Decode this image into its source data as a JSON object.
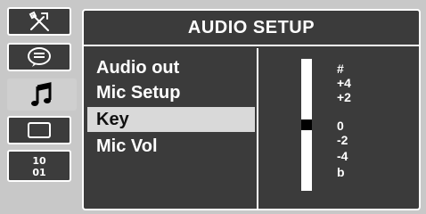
{
  "sidebar": {
    "tabs": [
      {
        "icon": "tools-icon",
        "active": false
      },
      {
        "icon": "speech-bubble-icon",
        "active": false
      },
      {
        "icon": "music-note-icon",
        "active": true
      },
      {
        "icon": "screen-icon",
        "active": false
      },
      {
        "icon": "numbers-icon",
        "active": false,
        "label": "10\n01"
      }
    ]
  },
  "panel": {
    "title": "AUDIO SETUP",
    "menu_items": [
      {
        "label": "Audio out",
        "selected": false
      },
      {
        "label": "Mic Setup",
        "selected": false
      },
      {
        "label": "Key",
        "selected": true
      },
      {
        "label": "Mic Vol",
        "selected": false
      }
    ]
  },
  "key_level": {
    "labels": [
      "#",
      "+4",
      "+2",
      "0",
      "-2",
      "-4",
      "b"
    ],
    "current": "0"
  },
  "colors": {
    "background": "#c8c8c8",
    "panel": "#3b3b3b",
    "selection": "#d9d9d9",
    "text": "#ffffff"
  }
}
